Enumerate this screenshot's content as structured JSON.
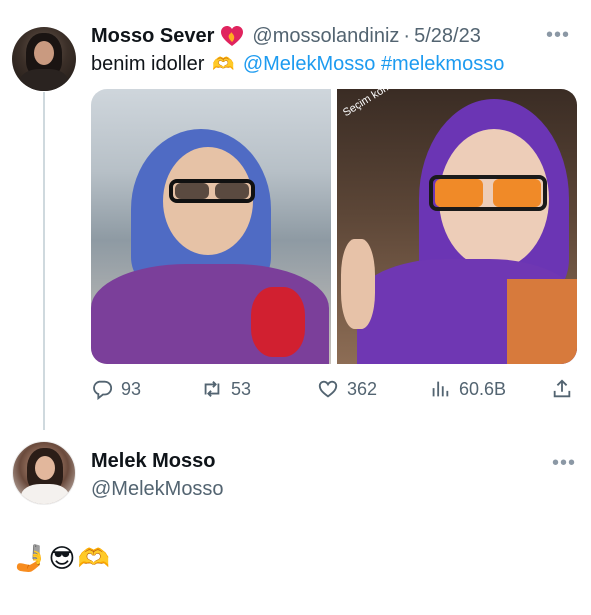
{
  "tweet": {
    "author_name": "Mosso Sever",
    "author_handle": "@mossolandiniz",
    "separator": "·",
    "date": "5/28/23",
    "more_icon": "•••",
    "text_prefix": "benim idoller",
    "hands_emoji": "🫶",
    "mention": "@MelekMosso",
    "hashtag": "#melekmosso",
    "photo_caption": "Seçim kombinim hazır",
    "actions": {
      "replies": "93",
      "retweets": "53",
      "likes": "362",
      "views": "60.6B"
    }
  },
  "reply": {
    "author_name": "Melek Mosso",
    "author_handle": "@MelekMosso",
    "more_icon": "•••",
    "text": "🤳😎🫶"
  },
  "colors": {
    "link": "#1d9bf0",
    "muted": "#536471",
    "thread_line": "#cfd9de"
  }
}
